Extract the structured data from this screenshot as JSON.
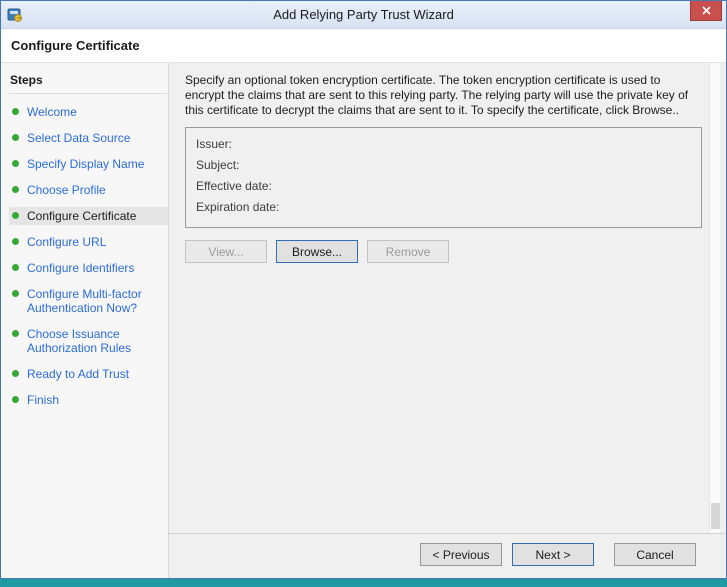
{
  "window": {
    "title": "Add Relying Party Trust Wizard"
  },
  "header": {
    "title": "Configure Certificate"
  },
  "sidebar": {
    "title": "Steps",
    "items": [
      {
        "label": "Welcome"
      },
      {
        "label": "Select Data Source"
      },
      {
        "label": "Specify Display Name"
      },
      {
        "label": "Choose Profile"
      },
      {
        "label": "Configure Certificate"
      },
      {
        "label": "Configure URL"
      },
      {
        "label": "Configure Identifiers"
      },
      {
        "label": "Configure Multi-factor Authentication Now?"
      },
      {
        "label": "Choose Issuance Authorization Rules"
      },
      {
        "label": "Ready to Add Trust"
      },
      {
        "label": "Finish"
      }
    ]
  },
  "main": {
    "instructions": "Specify an optional token encryption certificate.  The token encryption certificate is used to encrypt the claims that are sent to this relying party.  The relying party will use the private key of this certificate to decrypt the claims that are sent to it.  To specify the certificate, click Browse..",
    "certificate_fields": [
      "Issuer:",
      "Subject:",
      "Effective date:",
      "Expiration date:"
    ],
    "buttons": {
      "view": "View...",
      "browse": "Browse...",
      "remove": "Remove"
    }
  },
  "footer": {
    "previous": "< Previous",
    "next": "Next >",
    "cancel": "Cancel"
  },
  "colors": {
    "titlebar": "#dde7f5",
    "step_link": "#2b6cd9",
    "bullet_green": "#37a837",
    "close_red": "#c9504c",
    "desktop_teal": "#1f9aa3"
  }
}
